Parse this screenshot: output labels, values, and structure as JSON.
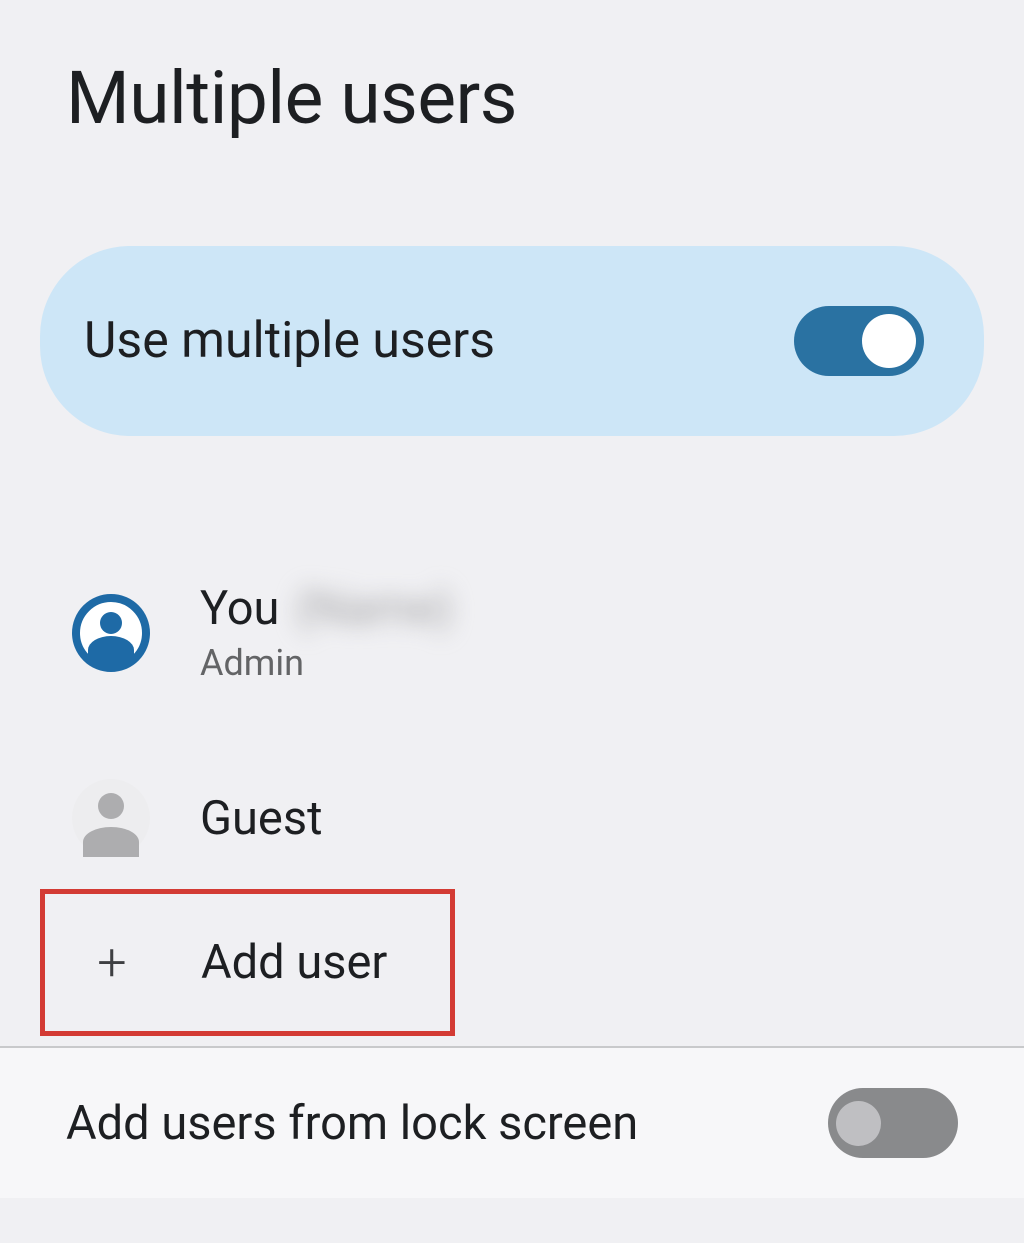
{
  "page": {
    "title": "Multiple users"
  },
  "toggle": {
    "label": "Use multiple users",
    "state": "on"
  },
  "users": [
    {
      "name": "You",
      "extra": "(Name)",
      "sub": "Admin",
      "type": "primary"
    },
    {
      "name": "Guest",
      "type": "guest"
    }
  ],
  "add": {
    "icon": "+",
    "label": "Add user"
  },
  "bottom": {
    "label": "Add users from lock screen",
    "state": "off"
  },
  "colors": {
    "accent": "#2a72a2",
    "card": "#cde6f7",
    "highlight_border": "#d33b34"
  }
}
